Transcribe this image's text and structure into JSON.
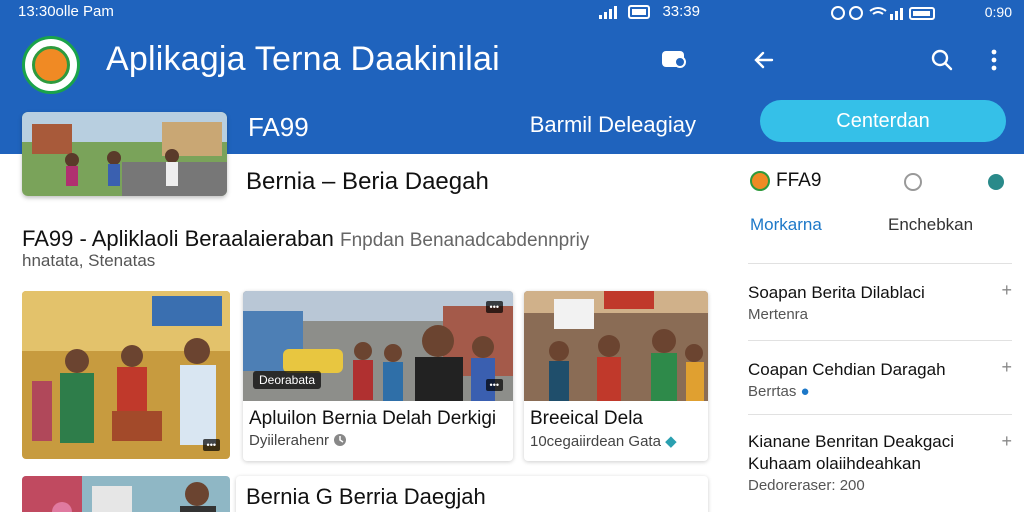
{
  "left_status": {
    "left": "13:30olle Pam",
    "time": "33:39"
  },
  "app": {
    "title": "Aplikagja Terna Daakinilai"
  },
  "hero": {
    "label": "FA99",
    "right_label": "Barmil Deleagiay",
    "caption": "Bernia – Beria Daegah"
  },
  "headline": {
    "main": "FA99 - Apliklaoli Beraalaieraban",
    "faded": "Fnpdan Benanadcabdennpriy",
    "sub": "hnatata, Stenatas"
  },
  "cards": [
    {
      "badge": "Deorabata",
      "title": "Apluilon Bernia Delah Derkigi",
      "meta": "Dyiilerahenr"
    },
    {
      "title": "Breeical Dela",
      "meta": "10cegaiirdean Gata"
    }
  ],
  "bottom": {
    "caption": "Bernia G Berria Daegjah"
  },
  "right_status": {
    "time": "0:90"
  },
  "right_panel": {
    "button": "Centerdan",
    "brand": "FFA9",
    "tab_active": "Morkarna",
    "tab_other": "Enchebkan",
    "items": [
      {
        "title": "Soapan Berita Dilablaci",
        "sub": "Mertenra"
      },
      {
        "title": "Coapan Cehdian Daragah",
        "sub": "Berrtas"
      },
      {
        "title": "Kianane Benritan Deakgaci Kuhaam olaiihdeahkan",
        "sub": "Dedoreraser: 200"
      }
    ]
  },
  "colors": {
    "primary": "#1f63bd",
    "accent": "#35c0e8",
    "tab_active": "#1d78c8"
  }
}
